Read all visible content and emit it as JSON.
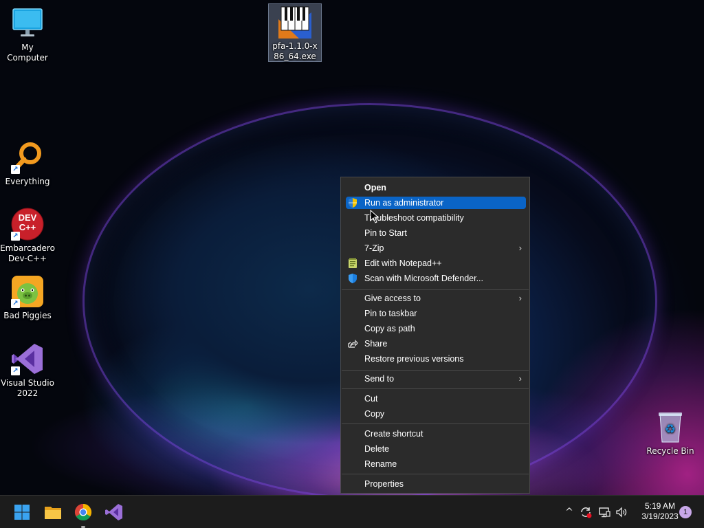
{
  "desktop": {
    "icons": {
      "my_computer": {
        "label": "My Computer",
        "icon": "monitor-icon"
      },
      "pfa": {
        "label": "pfa-1.1.0-x86_64.exe",
        "icon": "piano-installer-icon"
      },
      "everything": {
        "label": "Everything",
        "icon": "magnifier-icon"
      },
      "devcpp": {
        "label": "Embarcadero Dev-C++",
        "icon": "devcpp-icon",
        "badge": "DEV C++"
      },
      "bad_piggies": {
        "label": "Bad Piggies",
        "icon": "pig-icon"
      },
      "visual_studio": {
        "label": "Visual Studio 2022",
        "icon": "visual-studio-icon"
      },
      "recycle_bin": {
        "label": "Recycle Bin",
        "icon": "recycle-bin-icon"
      }
    }
  },
  "context_menu": {
    "items": [
      {
        "label": "Open",
        "bold": true
      },
      {
        "label": "Run as administrator",
        "icon": "uac-shield-icon",
        "highlighted": true
      },
      {
        "label": "Troubleshoot compatibility"
      },
      {
        "label": "Pin to Start"
      },
      {
        "label": "7-Zip",
        "submenu": true
      },
      {
        "label": "Edit with Notepad++",
        "icon": "notepad-plus-plus-icon"
      },
      {
        "label": "Scan with Microsoft Defender...",
        "icon": "defender-shield-icon"
      },
      {
        "label": "Give access to",
        "submenu": true
      },
      {
        "label": "Pin to taskbar"
      },
      {
        "label": "Copy as path"
      },
      {
        "label": "Share",
        "icon": "share-icon"
      },
      {
        "label": "Restore previous versions"
      },
      {
        "label": "Send to",
        "submenu": true
      },
      {
        "label": "Cut"
      },
      {
        "label": "Copy"
      },
      {
        "label": "Create shortcut"
      },
      {
        "label": "Delete"
      },
      {
        "label": "Rename"
      },
      {
        "label": "Properties"
      }
    ],
    "submenu_glyph": "›"
  },
  "taskbar": {
    "apps": [
      "windows-start-icon",
      "file-explorer-icon",
      "chrome-icon",
      "visual-studio-icon"
    ],
    "tray": {
      "chevron": "^",
      "clock_time": "5:19 AM",
      "clock_date": "3/19/2023",
      "notification_count": "1"
    }
  },
  "colors": {
    "menu_bg": "#2b2b2b",
    "menu_highlight": "#0a64c6",
    "taskbar_bg": "#1c1c1c"
  }
}
